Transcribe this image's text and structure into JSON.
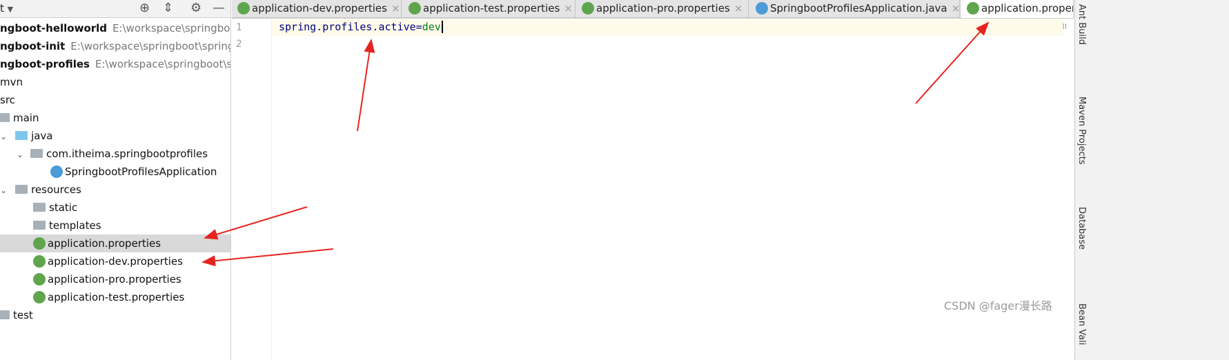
{
  "sidebar": {
    "header_label": "t",
    "icons": [
      "locate-icon",
      "collapse-icon",
      "gear-icon",
      "minimize-icon"
    ],
    "tree": [
      {
        "label": "ngboot-helloworld",
        "path": "E:\\workspace\\springboot\\"
      },
      {
        "label": "ngboot-init",
        "path": "E:\\workspace\\springboot\\springb"
      },
      {
        "label": "ngboot-profiles",
        "path": "E:\\workspace\\springboot\\sp"
      },
      {
        "label": "mvn"
      },
      {
        "label": "src"
      },
      {
        "label": "main"
      },
      {
        "label": "java"
      },
      {
        "label": "com.itheima.springbootprofiles"
      },
      {
        "label": "SpringbootProfilesApplication"
      },
      {
        "label": "resources"
      },
      {
        "label": "static"
      },
      {
        "label": "templates"
      },
      {
        "label": "application.properties"
      },
      {
        "label": "application-dev.properties"
      },
      {
        "label": "application-pro.properties"
      },
      {
        "label": "application-test.properties"
      },
      {
        "label": "test"
      }
    ]
  },
  "tabs": [
    {
      "label": "application-dev.properties",
      "close": "×"
    },
    {
      "label": "application-test.properties",
      "close": "×"
    },
    {
      "label": "application-pro.properties",
      "close": "×"
    },
    {
      "label": "SpringbootProfilesApplication.java",
      "close": "×"
    },
    {
      "label": "application.proper"
    }
  ],
  "editor": {
    "line_numbers": [
      "1",
      "2"
    ],
    "code_key": "spring.profiles.active=",
    "code_value": "dev"
  },
  "right_tools": [
    "Ant Build",
    "Maven Projects",
    "Database",
    "Bean Vali"
  ],
  "watermark": "CSDN @fager漫长路",
  "colors": {
    "annotation_arrow": "#e8231f",
    "selected_row": "#d9d9d9",
    "current_line": "#fefbea"
  }
}
